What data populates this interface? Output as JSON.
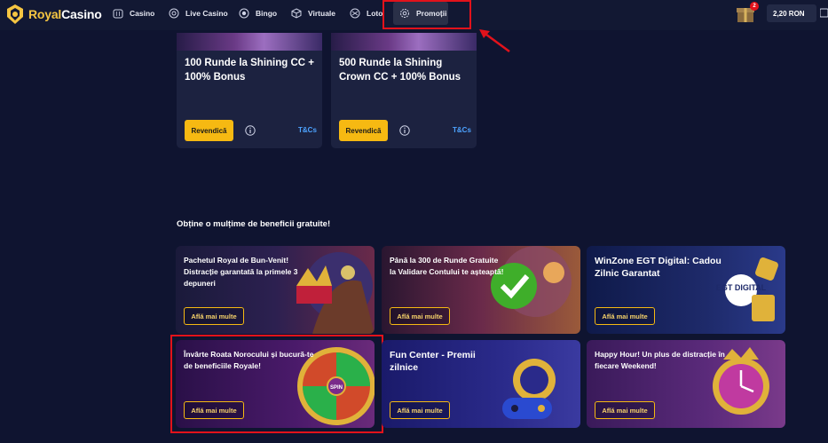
{
  "header": {
    "logo_royal": "Royal",
    "logo_casino": "Casino",
    "nav": [
      "Casino",
      "Live Casino",
      "Bingo",
      "Virtuale",
      "Loto",
      "Promoții"
    ],
    "gift_badge": "2",
    "balance": "2,20 RON"
  },
  "promo_cards": [
    {
      "title": "100 Runde la Shining CC + 100% Bonus",
      "claim_label": "Revendică",
      "tc_label": "T&Cs"
    },
    {
      "title": "500 Runde la Shining Crown CC + 100% Bonus",
      "claim_label": "Revendică",
      "tc_label": "T&Cs"
    }
  ],
  "section_title": "Obține o mulțime de beneficii gratuite!",
  "benefit_cards": [
    {
      "text": "Pachetul Royal de Bun-Venit! Distracție garantată la primele 3 depuneri",
      "button": "Află mai multe"
    },
    {
      "text": "Până la 300 de Runde Gratuite la Validare Contului te așteaptă!",
      "button": "Află mai multe"
    },
    {
      "text": "WinZone EGT Digital: Cadou Zilnic Garantat",
      "button": "Află mai multe"
    },
    {
      "text": "Învârte Roata Norocului și bucură-te de beneficiile Royale!",
      "button": "Află mai multe"
    },
    {
      "text": "Fun Center - Premii zilnice",
      "button": "Află mai multe"
    },
    {
      "text": "Happy Hour! Un plus de distracție în fiecare Weekend!",
      "button": "Află mai multe"
    }
  ],
  "wheel_center": "SPIN",
  "egt_logo": "EGT DIGITAL",
  "colors": {
    "background": "#0f1430",
    "accent_yellow": "#f6b912",
    "link_blue": "#4da3ff",
    "highlight_red": "#e2121b"
  }
}
